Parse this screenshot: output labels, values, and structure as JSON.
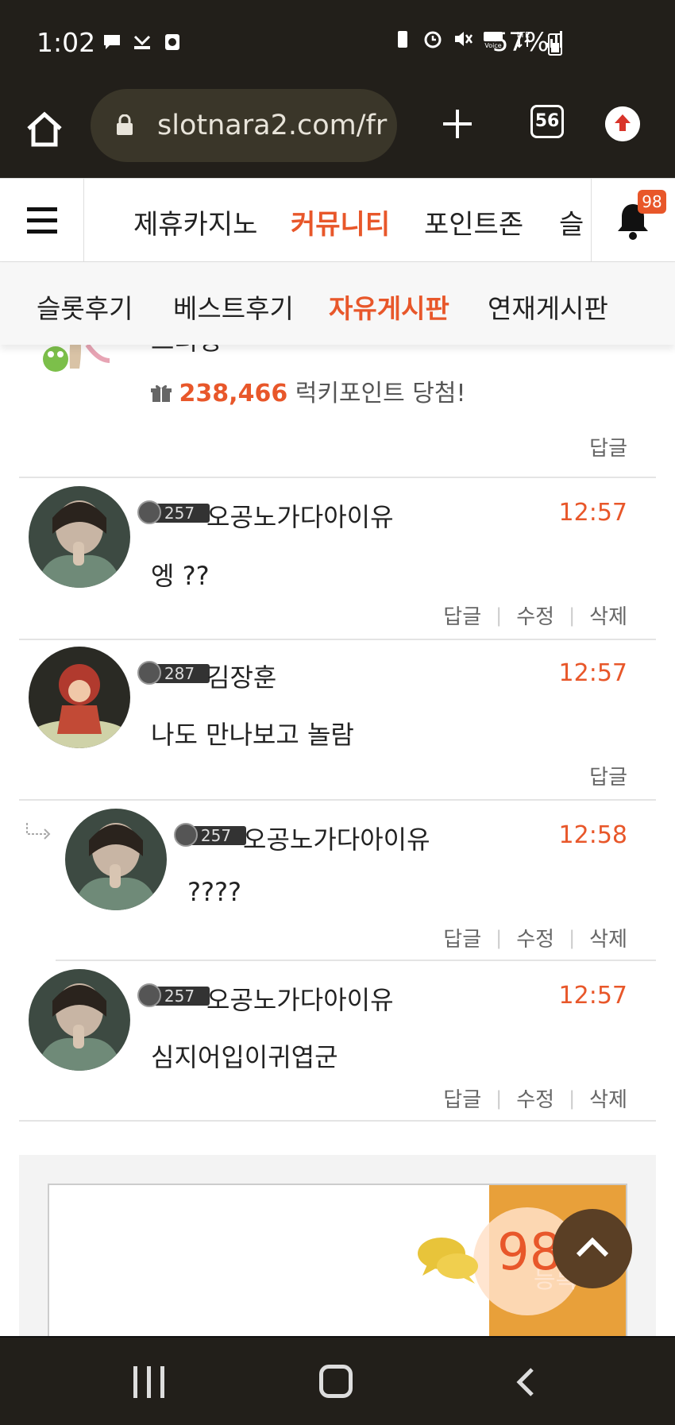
{
  "status_bar": {
    "time": "1:02",
    "battery": "57%",
    "icons": [
      "chat-bubble-icon",
      "missed-call-icon",
      "screen-record-icon",
      "battery-saver-icon",
      "alarm-icon",
      "mute-icon",
      "hd-voice-icon",
      "lte-icon",
      "signal-icon",
      "battery-icon"
    ]
  },
  "browser": {
    "url": "slotnara2.com/fr",
    "tab_count": "56"
  },
  "site_nav": {
    "items": [
      {
        "label": "제휴카지노"
      },
      {
        "label": "커뮤니티"
      },
      {
        "label": "포인트존"
      },
      {
        "label": "슬"
      }
    ],
    "active_index": 1,
    "notification_count": "98"
  },
  "sub_nav": {
    "items": [
      {
        "label": "슬롯후기"
      },
      {
        "label": "베스트후기"
      },
      {
        "label": "자유게시판"
      },
      {
        "label": "연재게시판"
      }
    ],
    "active_index": 2
  },
  "comments": [
    {
      "author": "그러넹",
      "lucky_points": "238,466",
      "lucky_text": "럭키포인트 당첨!",
      "actions": [
        "답글"
      ]
    },
    {
      "level": "257",
      "author": "오공노가다아이유",
      "time": "12:57",
      "text": "엥 ??",
      "actions": [
        "답글",
        "수정",
        "삭제"
      ]
    },
    {
      "level": "287",
      "author": "김장훈",
      "time": "12:57",
      "text": "나도 만나보고 놀람",
      "actions": [
        "답글"
      ]
    },
    {
      "level": "257",
      "author": "오공노가다아이유",
      "time": "12:58",
      "text": "????",
      "actions": [
        "답글",
        "수정",
        "삭제"
      ],
      "is_reply": true
    },
    {
      "level": "257",
      "author": "오공노가다아이유",
      "time": "12:57",
      "text": "심지어입이귀엽군",
      "actions": [
        "답글",
        "수정",
        "삭제"
      ]
    }
  ],
  "comment_form": {
    "comment_count": "98",
    "submit_label": "등록"
  },
  "colors": {
    "accent": "#e8572a",
    "submit": "#e8a03a",
    "dark_bar": "#221f1a"
  }
}
